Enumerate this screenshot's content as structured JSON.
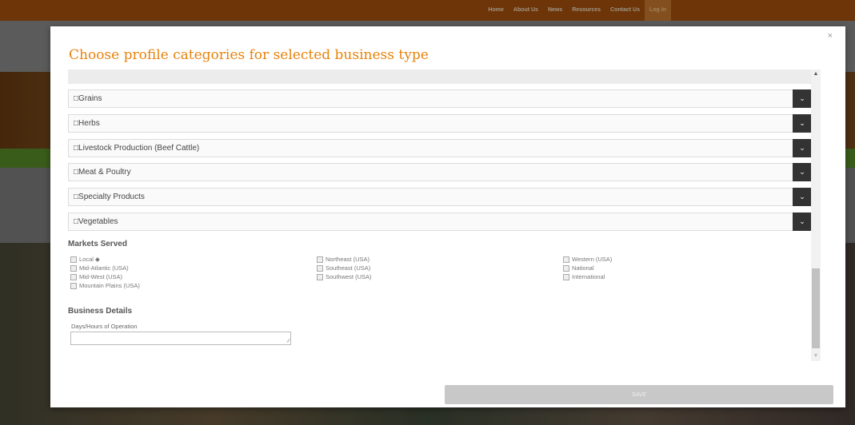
{
  "nav": {
    "items": [
      "Home",
      "About Us",
      "News",
      "Resources",
      "Contact Us"
    ],
    "login": "Log In"
  },
  "modal": {
    "title": "Choose profile categories for selected business type",
    "close": "×",
    "categories": [
      "□Grains",
      "□Herbs",
      "□Livestock Production (Beef Cattle)",
      "□Meat & Poultry",
      "□Specialty Products",
      "□Vegetables"
    ],
    "markets_heading": "Markets Served",
    "markets": {
      "col1": [
        "Local ◆",
        "Mid-Atlantic (USA)",
        "Mid-West (USA)",
        "Mountain Plains (USA)"
      ],
      "col2": [
        "Northeast (USA)",
        "Southeast (USA)",
        "Southwest (USA)"
      ],
      "col3": [
        "Western (USA)",
        "National",
        "International"
      ]
    },
    "business_heading": "Business Details",
    "hours_label": "Days/Hours of Operation",
    "hours_value": "",
    "save_label": "SAVE"
  },
  "colors": {
    "title": "#e8820c",
    "topbar": "#a8520d",
    "toggle": "#333333"
  }
}
